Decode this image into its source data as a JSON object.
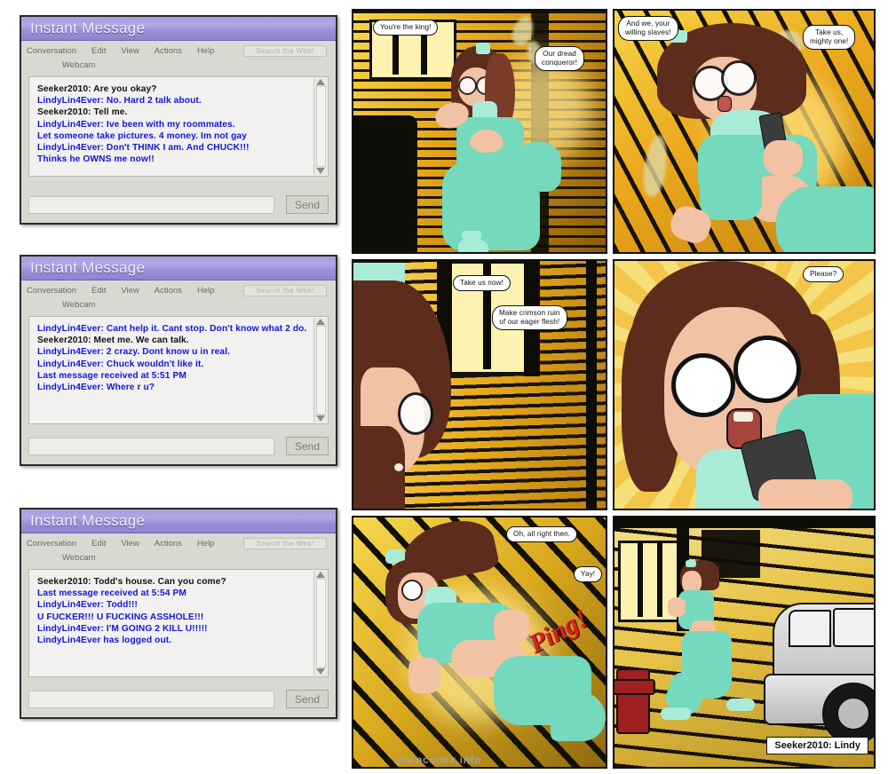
{
  "windows": [
    {
      "title": "Instant Message",
      "menu": [
        "Conversation",
        "Edit",
        "View",
        "Actions",
        "Help"
      ],
      "submenu": "Webcam",
      "search_placeholder": "Search the Web!",
      "send_label": "Send",
      "compose_value": "",
      "messages": [
        {
          "text": "Seeker2010: Are you okay?",
          "who": "self"
        },
        {
          "text": "LindyLin4Ever: No. Hard 2 talk about.",
          "who": "other"
        },
        {
          "text": "Seeker2010: Tell me.",
          "who": "self"
        },
        {
          "text": "LindyLin4Ever: Ive been with my roommates.",
          "who": "other"
        },
        {
          "text": "Let someone take pictures. 4 money. Im not gay",
          "who": "other"
        },
        {
          "text": "LindyLin4Ever: Don't THINK I am. And CHUCK!!!",
          "who": "other"
        },
        {
          "text": "Thinks he OWNS me now!!",
          "who": "other"
        }
      ]
    },
    {
      "title": "Instant Message",
      "menu": [
        "Conversation",
        "Edit",
        "View",
        "Actions",
        "Help"
      ],
      "submenu": "Webcam",
      "search_placeholder": "Search the Web!",
      "send_label": "Send",
      "compose_value": "",
      "messages": [
        {
          "text": "LindyLin4Ever: Cant help it. Cant stop. Don't know what 2 do.",
          "who": "other"
        },
        {
          "text": "Seeker2010: Meet me. We can talk.",
          "who": "self"
        },
        {
          "text": "LindyLin4Ever: 2 crazy. Dont know u in real.",
          "who": "other"
        },
        {
          "text": "LindyLin4Ever: Chuck wouldn't like it.",
          "who": "other"
        },
        {
          "text": "Last message received at 5:51 PM",
          "who": "other"
        },
        {
          "text": "LindyLin4Ever: Where r u?",
          "who": "other"
        }
      ]
    },
    {
      "title": "Instant Message",
      "menu": [
        "Conversation",
        "Edit",
        "View",
        "Actions",
        "Help"
      ],
      "submenu": "Webcam",
      "search_placeholder": "Search the Web!",
      "send_label": "Send",
      "compose_value": "",
      "messages": [
        {
          "text": "Seeker2010: Todd's house. Can you come?",
          "who": "self"
        },
        {
          "text": "Last message received at 5:54 PM",
          "who": "other"
        },
        {
          "text": "LindyLin4Ever: Todd!!!",
          "who": "other"
        },
        {
          "text": "U FUCKER!!! U FUCKING ASSHOLE!!!",
          "who": "other"
        },
        {
          "text": "LindyLin4Ever: I'M GOING 2 KILL U!!!!!",
          "who": "other"
        },
        {
          "text": "LindyLin4Ever has logged out.",
          "who": "other"
        }
      ]
    }
  ],
  "comic": {
    "panels": [
      {
        "id": "panel-1",
        "bubbles": [
          "You're the king!",
          "Our dread\nconqueror!"
        ]
      },
      {
        "id": "panel-2",
        "bubbles": [
          "And we, your\nwilling slaves!",
          "Take us,\nmighty one!"
        ]
      },
      {
        "id": "panel-3",
        "bubbles": [
          "Take us now!",
          "Make crimson ruin\nof our eager flesh!"
        ]
      },
      {
        "id": "panel-4",
        "bubbles": [
          "Please?"
        ]
      },
      {
        "id": "panel-5",
        "bubbles": [
          "Oh, all right then.",
          "Yay!"
        ],
        "sfx": "Ping!"
      },
      {
        "id": "panel-6",
        "caption": "Seeker2010: Lindy"
      }
    ]
  },
  "watermark": "porncomix.info",
  "colors": {
    "titlebar_purple": "#9a8fd6",
    "chat_self": "#111111",
    "chat_other": "#1414e0",
    "window_chrome": "#d9d9d2",
    "comic_yellow": "#e8a81a",
    "scrub_green": "#74d9bd",
    "sfx_red": "#d8231f"
  }
}
